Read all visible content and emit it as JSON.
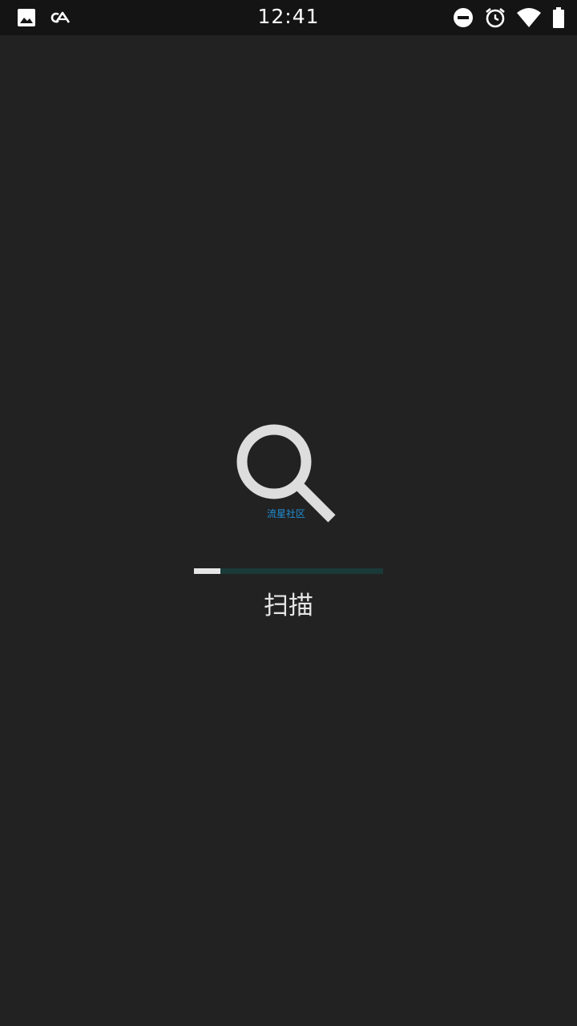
{
  "status_bar": {
    "time": "12:41",
    "left_icons": [
      "image-icon",
      "link-icon"
    ],
    "right_icons": [
      "do-not-disturb-icon",
      "alarm-icon",
      "wifi-icon",
      "battery-icon"
    ]
  },
  "splash": {
    "logo_icon": "magnifier-icon",
    "logo_text": "流星社区",
    "logo_text_color": "#1f8fd6",
    "progress_fraction": 0.14,
    "label": "扫描"
  },
  "colors": {
    "background": "#222222",
    "status_bar": "#141414",
    "progress_track": "#1a3a38",
    "progress_fill": "#e6e6e6"
  }
}
